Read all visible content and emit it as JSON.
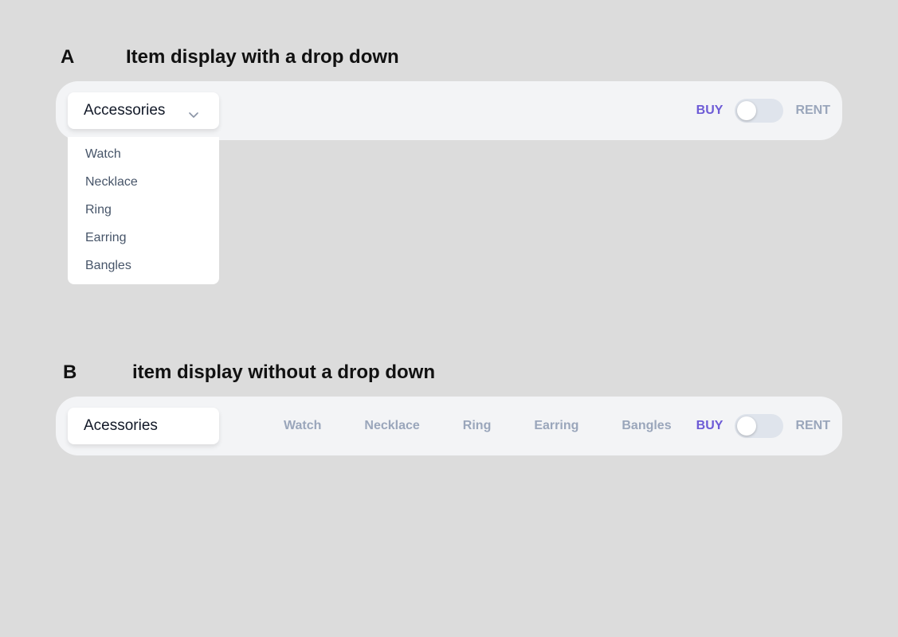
{
  "section_a": {
    "letter": "A",
    "title": "Item display with a drop down",
    "select": {
      "value": "Accessories",
      "icon": "chevron-down-icon"
    },
    "dropdown": {
      "items": [
        "Watch",
        "Necklace",
        "Ring",
        "Earring",
        "Bangles"
      ]
    },
    "toggle": {
      "left_label": "BUY",
      "right_label": "RENT",
      "state": "buy"
    }
  },
  "section_b": {
    "letter": "B",
    "title": "item display without a drop down",
    "select": {
      "value": "Acessories"
    },
    "tabs": [
      "Watch",
      "Necklace",
      "Ring",
      "Earring",
      "Bangles"
    ],
    "toggle": {
      "left_label": "BUY",
      "right_label": "RENT",
      "state": "buy"
    }
  },
  "colors": {
    "background": "#dcdcdc",
    "bar": "#f3f4f6",
    "accent": "#6d5bd6",
    "muted": "#9aa6bb"
  }
}
